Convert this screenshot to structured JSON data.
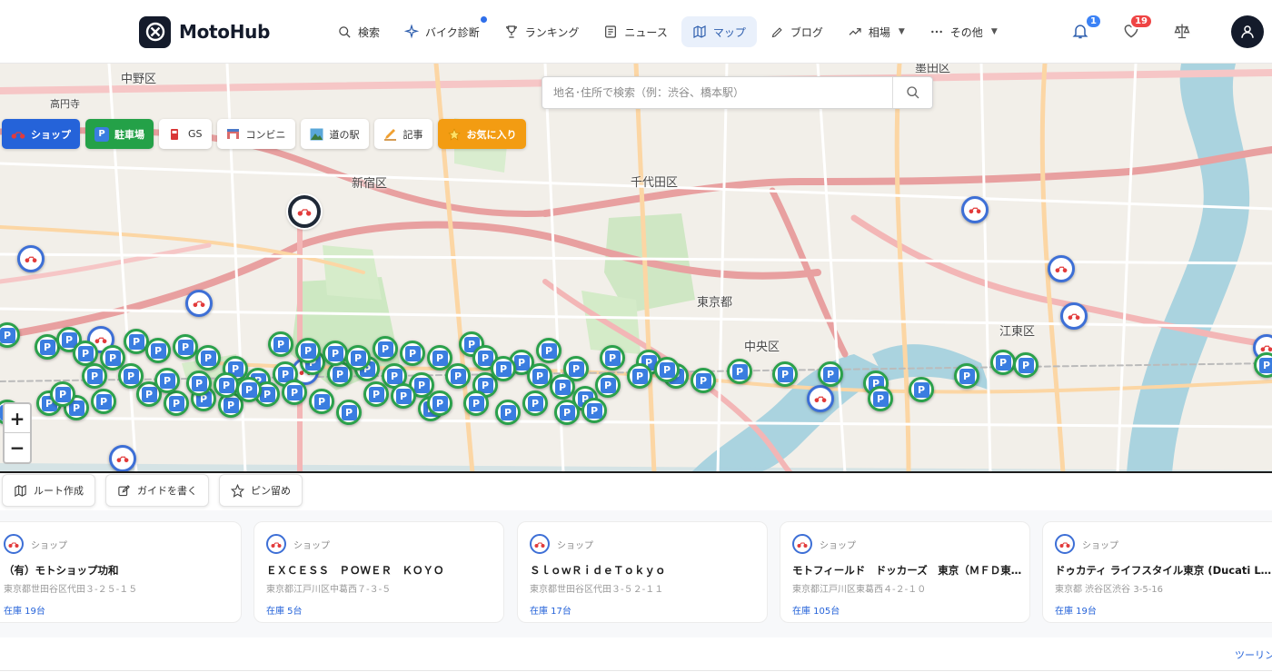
{
  "header": {
    "logo_text": "MotoHub",
    "nav": [
      {
        "label": "検索",
        "icon": "search-icon"
      },
      {
        "label": "バイク診断",
        "icon": "sparkle-icon"
      },
      {
        "label": "ランキング",
        "icon": "trophy-icon"
      },
      {
        "label": "ニュース",
        "icon": "newspaper-icon"
      },
      {
        "label": "マップ",
        "icon": "map-icon",
        "active": true
      },
      {
        "label": "ブログ",
        "icon": "pen-icon"
      },
      {
        "label": "相場",
        "icon": "trend-icon"
      },
      {
        "label": "その他",
        "icon": "more-icon"
      }
    ],
    "notifications_count": "1",
    "favorites_count": "19"
  },
  "map": {
    "search_placeholder": "地名･住所で検索（例：渋谷、橋本駅）",
    "filters": [
      {
        "label": "ショップ",
        "icon": "motorcycle-icon"
      },
      {
        "label": "駐車場",
        "icon": "parking-icon"
      },
      {
        "label": "GS",
        "icon": "fuel-icon"
      },
      {
        "label": "コンビニ",
        "icon": "store-icon"
      },
      {
        "label": "道の駅",
        "icon": "roadside-station-icon"
      },
      {
        "label": "記事",
        "icon": "article-icon"
      },
      {
        "label": "お気に入り",
        "icon": "star-icon"
      }
    ],
    "labels": {
      "nakano": "中野区",
      "shinjuku": "新宿区",
      "chiyoda": "千代田区",
      "tokyo": "東京都",
      "chuo": "中央区",
      "koto": "江東区",
      "sumida": "墨田区",
      "koenji": "高円寺"
    },
    "zoom_in": "+",
    "zoom_out": "−"
  },
  "actions": [
    {
      "label": "ルート作成",
      "icon": "map-icon"
    },
    {
      "label": "ガイドを書く",
      "icon": "edit-icon"
    },
    {
      "label": "ピン留め",
      "icon": "star-icon"
    }
  ],
  "cards": [
    {
      "type": "ショップ",
      "name": "（有）モトショップ功和",
      "address": "東京都世田谷区代田３-２５-１５",
      "stock": "在庫 19台"
    },
    {
      "type": "ショップ",
      "name": "ＥＸＣＥＳＳ　ＰＯＷＥＲ　ＫＯＹＯ",
      "address": "東京都江戸川区中葛西７-３-５",
      "stock": "在庫 5台"
    },
    {
      "type": "ショップ",
      "name": "ＳｌｏｗＲｉｄｅＴｏｋｙｏ",
      "address": "東京都世田谷区代田３-５２-１１",
      "stock": "在庫 17台"
    },
    {
      "type": "ショップ",
      "name": "モトフィールド　ドッカーズ　東京（ＭＦＤ東…",
      "address": "東京都江戸川区東葛西４-２-１０",
      "stock": "在庫 105台"
    },
    {
      "type": "ショップ",
      "name": "ドゥカティ ライフスタイル東京 (Ducati Lifestyl...",
      "address": "東京都 渋谷区渋谷 3-5-16",
      "stock": "在庫 19台"
    }
  ],
  "footer_link": "ツーリング"
}
